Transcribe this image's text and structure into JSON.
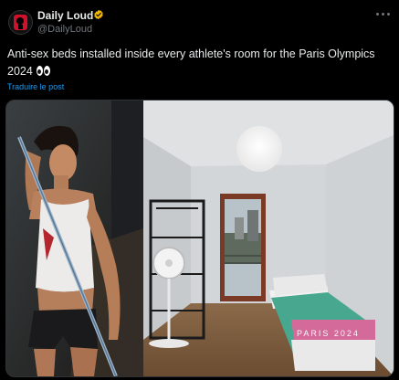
{
  "author": {
    "name": "Daily Loud",
    "handle": "@DailyLoud",
    "avatar_icon": "daily-loud-logo",
    "verified_color": "#f2b705"
  },
  "tweet": {
    "text": "Anti-sex beds installed inside every athlete's room for the Paris Olympics 2024",
    "emoji_icon": "eyes-emoji",
    "translate_label": "Traduire le post"
  },
  "media": {
    "bed_print": "PARIS 2024"
  },
  "colors": {
    "link": "#1d9bf0",
    "text": "#e7e9ea",
    "muted": "#71767b"
  }
}
